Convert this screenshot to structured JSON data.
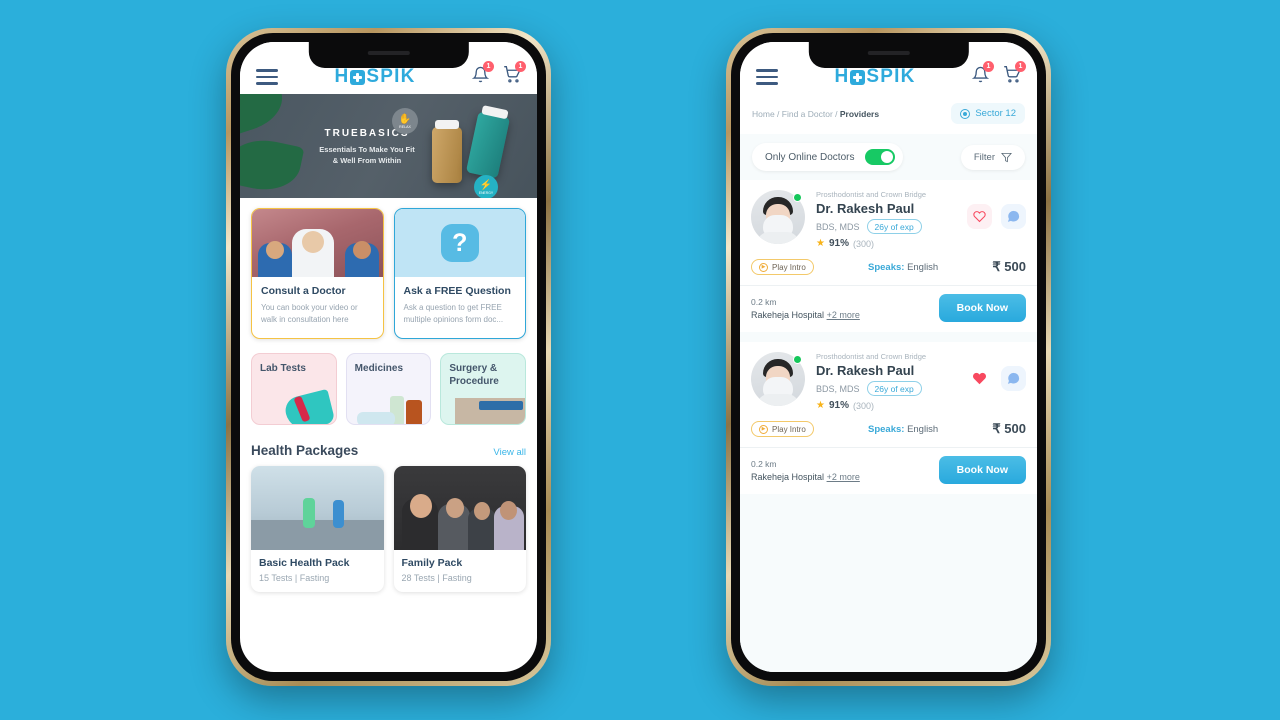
{
  "app": {
    "brand_prefix": "H",
    "brand_suffix": "SPIK",
    "notification_badge": "1",
    "cart_badge": "1"
  },
  "left_screen": {
    "banner": {
      "brand": "TRUEBASICS",
      "tagline_line1": "Essentials To Make You Fit",
      "tagline_line2": "& Well From Within",
      "icon_relax": "RELAX",
      "icon_energy": "ENERGY"
    },
    "feature_cards": [
      {
        "title": "Consult a Doctor",
        "desc": "You can book your video or walk in consultation here"
      },
      {
        "title": "Ask a FREE Question",
        "desc": "Ask a question to get FREE multiple opinions form doc..."
      }
    ],
    "tiles": [
      {
        "label": "Lab Tests"
      },
      {
        "label": "Medicines"
      },
      {
        "label": "Surgery & Procedure"
      }
    ],
    "section": {
      "title": "Health Packages",
      "view_all": "View all"
    },
    "packages": [
      {
        "title": "Basic Health Pack",
        "meta": "15 Tests | Fasting"
      },
      {
        "title": "Family Pack",
        "meta": "28 Tests | Fasting"
      }
    ]
  },
  "right_screen": {
    "breadcrumb": {
      "trail": "Home / Find a Doctor / ",
      "current": "Providers"
    },
    "location_chip": "Sector 12",
    "toggle": {
      "label": "Only Online Doctors",
      "state": "on"
    },
    "filter_label": "Filter",
    "doctors": [
      {
        "specialty": "Prosthodontist and Crown Bridge",
        "name": "Dr. Rakesh Paul",
        "degree": "BDS, MDS",
        "experience": "26y of exp",
        "rating_percent": "91%",
        "rating_count": "(300)",
        "play_intro": "Play Intro",
        "speaks_label": "Speaks:",
        "speaks_value": "English",
        "price": "₹ 500",
        "distance": "0.2 km",
        "hospital": "Rakeheja Hospital",
        "more_link": "+2 more",
        "book_label": "Book Now",
        "favorited": false,
        "online": true
      },
      {
        "specialty": "Prosthodontist and Crown Bridge",
        "name": "Dr. Rakesh Paul",
        "degree": "BDS, MDS",
        "experience": "26y of exp",
        "rating_percent": "91%",
        "rating_count": "(300)",
        "play_intro": "Play Intro",
        "speaks_label": "Speaks:",
        "speaks_value": "English",
        "price": "₹ 500",
        "distance": "0.2 km",
        "hospital": "Rakeheja Hospital",
        "more_link": "+2 more",
        "book_label": "Book Now",
        "favorited": true,
        "online": true
      }
    ]
  },
  "colors": {
    "page_background": "#2bafdb",
    "brand": "#2eaadc",
    "accent_blue": "#3aa9d8",
    "toggle_on": "#17c964",
    "badge_red": "#ff5f6d",
    "star_yellow": "#f8b319",
    "heart_filled": "#f8495f"
  }
}
